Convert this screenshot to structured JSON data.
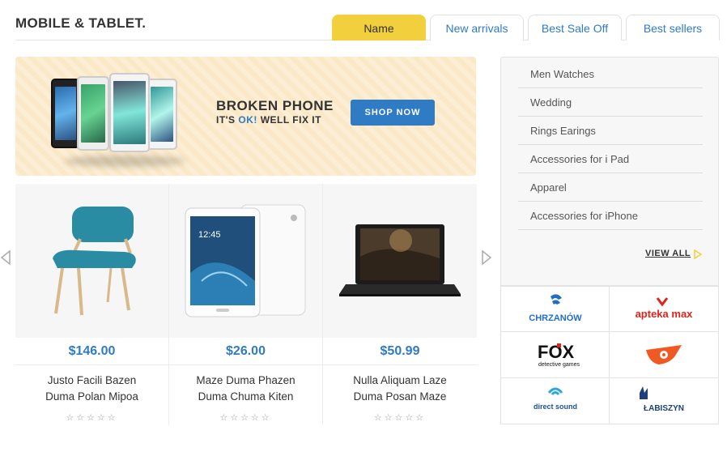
{
  "header": {
    "title": "MOBILE & TABLET.",
    "tabs": [
      {
        "label": "Name",
        "active": true
      },
      {
        "label": "New arrivals",
        "active": false
      },
      {
        "label": "Best Sale Off",
        "active": false
      },
      {
        "label": "Best sellers",
        "active": false
      }
    ]
  },
  "banner": {
    "title": "BROKEN PHONE",
    "subtitle_pre": "IT'S ",
    "subtitle_ok": "OK!",
    "subtitle_post": " WELL FIX IT",
    "button_label": "SHOP NOW"
  },
  "products": [
    {
      "price": "$146.00",
      "name_line1": "Justo Facili Bazen",
      "name_line2": "Duma Polan Mipoa",
      "rating": 0,
      "stars": "☆☆☆☆☆"
    },
    {
      "price": "$26.00",
      "name_line1": "Maze Duma Phazen",
      "name_line2": "Duma Chuma Kiten",
      "rating": 0,
      "stars": "☆☆☆☆☆"
    },
    {
      "price": "$50.99",
      "name_line1": "Nulla Aliquam Laze",
      "name_line2": "Duma Posan Maze",
      "rating": 0,
      "stars": "☆☆☆☆☆"
    }
  ],
  "sidebar": {
    "categories": [
      "Men Watches",
      "Wedding",
      "Rings Earings",
      "Accessories for i Pad",
      "Apparel",
      "Accessories for iPhone"
    ],
    "view_all": "VIEW ALL"
  },
  "brands": [
    {
      "name": "CHRZANÓW",
      "color": "#1f6fc4"
    },
    {
      "name": "apteka max",
      "color": "#e2231a"
    },
    {
      "name": "FOX",
      "tagline": "detective games",
      "color": "#111111"
    },
    {
      "name": "",
      "color": "#f05a22"
    },
    {
      "name": "direct sound",
      "color": "#1d4f9b"
    },
    {
      "name": "ŁABISZYN",
      "color": "#1d3f7a"
    }
  ],
  "colors": {
    "accent": "#2f7bc4",
    "tab_active": "#f2cf3c",
    "banner_bg": "#fbe8c6"
  }
}
